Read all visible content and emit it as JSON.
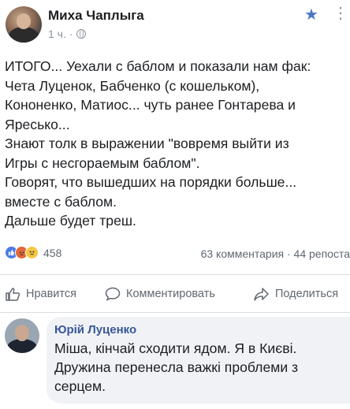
{
  "post": {
    "author": "Миха Чаплыга",
    "time": "1 ч. ·",
    "text": "ИТОГО... Уехали с баблом и показали нам фак:\nЧета Луценок, Бабченко (с кошельком),\nКононенко, Матиос... чуть ранее Гонтарева и\nЯресько...\nЗнают толк в выражении \"вовремя выйти из\nИгры с несгораемым баблом\".\nГоворят, что вышедших на порядки больше...\nвместе с баблом.\nДальше будет треш."
  },
  "stats": {
    "reaction_count": "458",
    "comments_and_shares": "63 комментария · 44 репоста"
  },
  "actions": {
    "like": "Нравится",
    "comment": "Комментировать",
    "share": "Поделиться"
  },
  "comment": {
    "author": "Юрій Луценко",
    "text": "Міша, кінчай сходити ядом. Я в Києві. Дружина перенесла важкі проблеми з серцем."
  },
  "icons": {
    "star": "star-icon",
    "globe": "globe-icon",
    "more": "more-icon"
  },
  "colors": {
    "accent": "#385898",
    "meta": "#8d949e"
  }
}
